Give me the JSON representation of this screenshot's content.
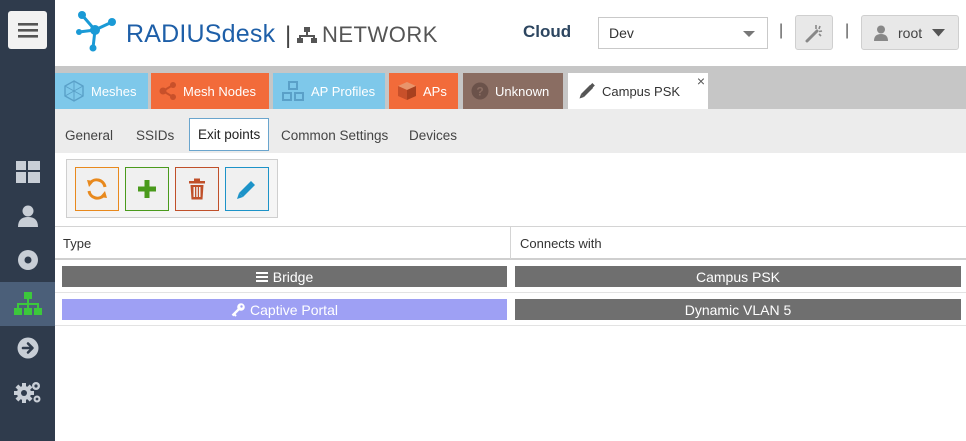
{
  "header": {
    "brand": "RADIUSdesk",
    "separator": "|",
    "section": "NETWORK",
    "cloud_label": "Cloud",
    "cloud_value": "Dev",
    "pipe": "|",
    "user": "root"
  },
  "leftnav": {
    "items": [
      {
        "icon": "dashboard-icon"
      },
      {
        "icon": "user-icon"
      },
      {
        "icon": "disc-icon"
      },
      {
        "icon": "network-icon",
        "active": true
      },
      {
        "icon": "arrow-right-circle-icon"
      },
      {
        "icon": "cogs-icon"
      }
    ]
  },
  "tabs": [
    {
      "label": "Meshes",
      "color": "#7ec8ea",
      "icon": "mesh-icon"
    },
    {
      "label": "Mesh Nodes",
      "color": "#f26b3a",
      "icon": "share-icon"
    },
    {
      "label": "AP Profiles",
      "color": "#7ec8ea",
      "icon": "cubes-icon"
    },
    {
      "label": "APs",
      "color": "#f26b3a",
      "icon": "cube-icon"
    },
    {
      "label": "Unknown",
      "color": "#8a6d62",
      "icon": "question-icon"
    },
    {
      "label": "Campus PSK",
      "active": true,
      "icon": "pencil-icon",
      "close": "×"
    }
  ],
  "subtabs": [
    {
      "label": "General"
    },
    {
      "label": "SSIDs"
    },
    {
      "label": "Exit points",
      "active": true
    },
    {
      "label": "Common Settings"
    },
    {
      "label": "Devices"
    }
  ],
  "toolbar": {
    "buttons": [
      {
        "name": "reload-button",
        "icon": "refresh-icon",
        "color": "#e8891d"
      },
      {
        "name": "add-button",
        "icon": "plus-icon",
        "color": "#4a9a1c"
      },
      {
        "name": "delete-button",
        "icon": "trash-icon",
        "color": "#c0502a"
      },
      {
        "name": "edit-button",
        "icon": "pencil-icon",
        "color": "#1d93c8"
      }
    ]
  },
  "grid": {
    "columns": [
      "Type",
      "Connects with"
    ],
    "rows": [
      {
        "type": "Bridge",
        "type_icon": "bars-icon",
        "type_color": "#6f6f6f",
        "connects": "Campus PSK",
        "connects_color": "#6f6f6f"
      },
      {
        "type": "Captive Portal",
        "type_icon": "key-icon",
        "type_color": "#9ea0f4",
        "connects": "Dynamic VLAN 5",
        "connects_color": "#6f6f6f"
      }
    ]
  }
}
